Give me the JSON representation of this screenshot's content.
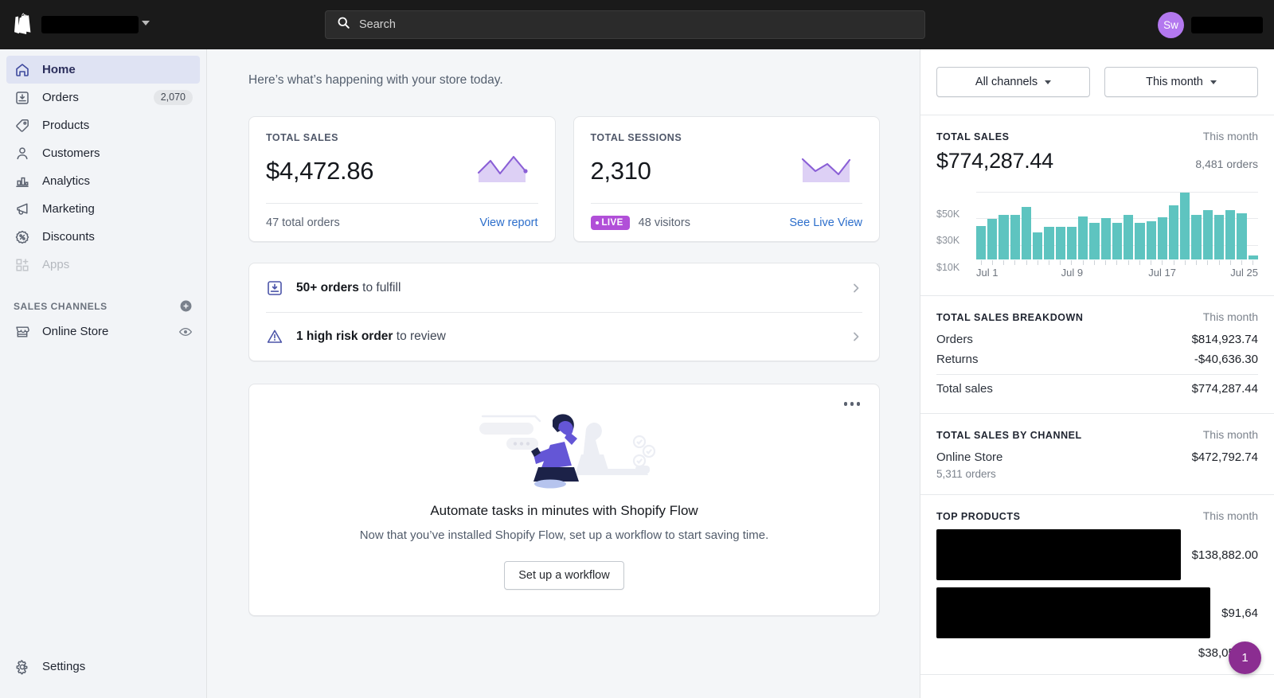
{
  "topbar": {
    "logo_icon": "shopify-bag-icon",
    "store_name_redacted": true,
    "search": {
      "placeholder": "Search",
      "value": "",
      "icon": "search-icon"
    },
    "user": {
      "initials": "Sw",
      "name_redacted": true
    }
  },
  "sidebar": {
    "items": [
      {
        "label": "Home",
        "icon": "home-icon",
        "active": true,
        "badge": ""
      },
      {
        "label": "Orders",
        "icon": "orders-icon",
        "active": false,
        "badge": "2,070"
      },
      {
        "label": "Products",
        "icon": "tag-icon",
        "active": false,
        "badge": ""
      },
      {
        "label": "Customers",
        "icon": "person-icon",
        "active": false,
        "badge": ""
      },
      {
        "label": "Analytics",
        "icon": "bar-chart-icon",
        "active": false,
        "badge": ""
      },
      {
        "label": "Marketing",
        "icon": "megaphone-icon",
        "active": false,
        "badge": ""
      },
      {
        "label": "Discounts",
        "icon": "discount-icon",
        "active": false,
        "badge": ""
      },
      {
        "label": "Apps",
        "icon": "apps-grid-icon",
        "active": false,
        "badge": "",
        "disabled": true
      }
    ],
    "sales_channels": {
      "title": "SALES CHANNELS",
      "add_icon": "plus-circle-icon",
      "items": [
        {
          "label": "Online Store",
          "icon": "storefront-icon",
          "action_icon": "eye-icon"
        }
      ]
    },
    "settings": {
      "label": "Settings",
      "icon": "gear-icon"
    }
  },
  "main": {
    "greeting": "Here’s what’s happening with your store today.",
    "metrics": [
      {
        "title": "TOTAL SALES",
        "value": "$4,472.86",
        "footer_text": "47 total orders",
        "link": "View report",
        "sparkline_icon": "sparkline-area-icon",
        "live": false
      },
      {
        "title": "TOTAL SESSIONS",
        "value": "2,310",
        "footer_text": "48 visitors",
        "link": "See Live View",
        "sparkline_icon": "sparkline-area-icon",
        "live": true,
        "live_label": "LIVE"
      }
    ],
    "actions": [
      {
        "icon": "orders-icon",
        "strong": "50+ orders",
        "rest": " to fulfill",
        "chevron": "chevron-right-icon"
      },
      {
        "icon": "warning-icon",
        "strong": "1 high risk order",
        "rest": " to review",
        "chevron": "chevron-right-icon"
      }
    ],
    "promo": {
      "menu_icon": "ellipsis-icon",
      "illustration_icon": "people-with-devices-illustration",
      "title": "Automate tasks in minutes with Shopify Flow",
      "subtitle": "Now that you’ve installed Shopify Flow, set up a workflow to start saving time.",
      "button_label": "Set up a workflow"
    }
  },
  "right_panel": {
    "filters": [
      {
        "label": "All channels",
        "icon": "chevron-down-icon"
      },
      {
        "label": "This month",
        "icon": "chevron-down-icon"
      }
    ],
    "total_sales": {
      "title": "TOTAL SALES",
      "period": "This month",
      "value": "$774,287.44",
      "orders": "8,481 orders"
    },
    "breakdown": {
      "title": "TOTAL SALES BREAKDOWN",
      "period": "This month",
      "rows": [
        {
          "label": "Orders",
          "value": "$814,923.74"
        },
        {
          "label": "Returns",
          "value": "-$40,636.30"
        }
      ],
      "total": {
        "label": "Total sales",
        "value": "$774,287.44"
      }
    },
    "by_channel": {
      "title": "TOTAL SALES BY CHANNEL",
      "period": "This month",
      "rows": [
        {
          "label": "Online Store",
          "value": "$472,792.74",
          "sub": "5,311 orders"
        }
      ]
    },
    "top_products": {
      "title": "TOP PRODUCTS",
      "period": "This month",
      "rows": [
        {
          "name_redacted": true,
          "value": "$138,882.00"
        },
        {
          "name_redacted": true,
          "value": "$91,64"
        },
        {
          "name_redacted": false,
          "value": "$38,059.84"
        }
      ]
    },
    "help_badge": "1"
  },
  "colors": {
    "topbar_bg": "#1a1a1a",
    "sidebar_bg": "#f2f4f7",
    "page_bg": "#f4f6f8",
    "accent_link": "#2c6ecb",
    "nav_active_bg": "#dfe3f3",
    "nav_active_text": "#2c2f5c",
    "chart_bar": "#5ec4c0",
    "sparkline_stroke": "#8a5fd6",
    "sparkline_fill": "#ddd0f5",
    "live_badge": "#b14fd8",
    "avatar_bg": "#b378ef",
    "help_badge_bg": "#8b2d91"
  },
  "chart_data": {
    "type": "bar",
    "title": "TOTAL SALES",
    "xlabel": "",
    "ylabel": "",
    "ylim": [
      0,
      58000
    ],
    "grid": true,
    "ytick_labels": [
      "$50K",
      "$30K",
      "$10K"
    ],
    "ytick_values": [
      50000,
      30000,
      10000
    ],
    "xtick_labels": [
      "Jul 1",
      "Jul 9",
      "Jul 17",
      "Jul 25"
    ],
    "xtick_positions": [
      0,
      8,
      16,
      24
    ],
    "categories": [
      "Jul 1",
      "Jul 2",
      "Jul 3",
      "Jul 4",
      "Jul 5",
      "Jul 6",
      "Jul 7",
      "Jul 8",
      "Jul 9",
      "Jul 10",
      "Jul 11",
      "Jul 12",
      "Jul 13",
      "Jul 14",
      "Jul 15",
      "Jul 16",
      "Jul 17",
      "Jul 18",
      "Jul 19",
      "Jul 20",
      "Jul 21",
      "Jul 22",
      "Jul 23",
      "Jul 24",
      "Jul 25"
    ],
    "values": [
      25000,
      30000,
      33000,
      33000,
      39000,
      20000,
      24000,
      24500,
      24000,
      32000,
      27000,
      31000,
      27000,
      33000,
      27500,
      28500,
      31500,
      40000,
      50000,
      33000,
      36500,
      33000,
      36500,
      34500,
      3000
    ]
  }
}
